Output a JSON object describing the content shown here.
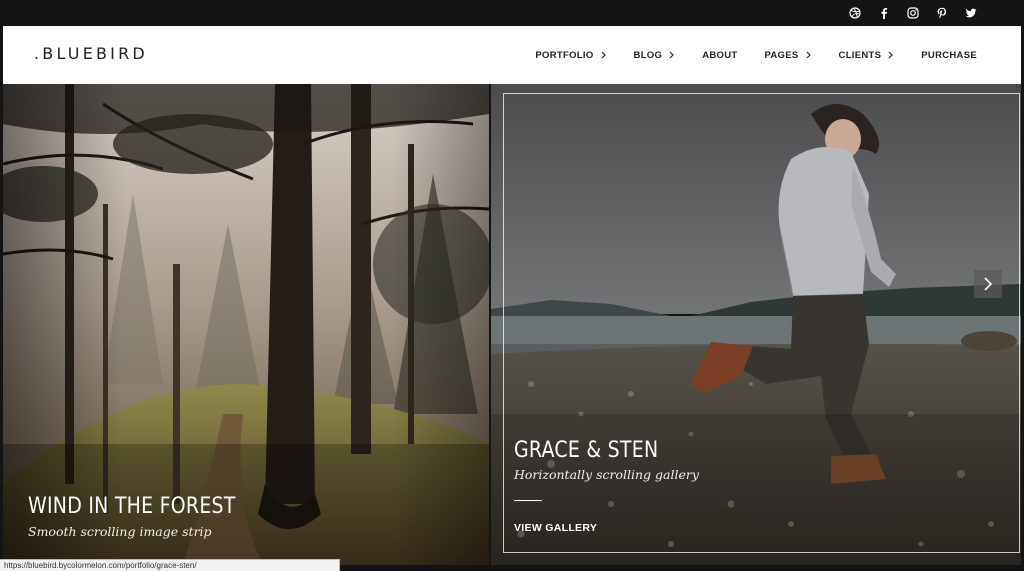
{
  "social": {
    "icons": [
      "dribbble-icon",
      "facebook-icon",
      "instagram-icon",
      "pinterest-icon",
      "twitter-icon"
    ]
  },
  "header": {
    "logo": ".BLUEBIRD",
    "nav": [
      {
        "label": "PORTFOLIO",
        "has_submenu": true
      },
      {
        "label": "BLOG",
        "has_submenu": true
      },
      {
        "label": "ABOUT",
        "has_submenu": false
      },
      {
        "label": "PAGES",
        "has_submenu": true
      },
      {
        "label": "CLIENTS",
        "has_submenu": true
      },
      {
        "label": "PURCHASE",
        "has_submenu": false
      }
    ]
  },
  "gallery": {
    "left": {
      "title": "WIND IN THE FOREST",
      "subtitle": "Smooth scrolling image strip"
    },
    "right": {
      "title": "GRACE & STEN",
      "subtitle": "Horizontally scrolling gallery",
      "link": "VIEW GALLERY"
    },
    "next_icon": "chevron-right-icon"
  },
  "status_bar": {
    "url": "https://bluebird.bycolormelon.com/portfolio/grace-sten/"
  },
  "colors": {
    "page_bg": "#141414",
    "header_bg": "#ffffff",
    "text_dark": "#222222"
  }
}
